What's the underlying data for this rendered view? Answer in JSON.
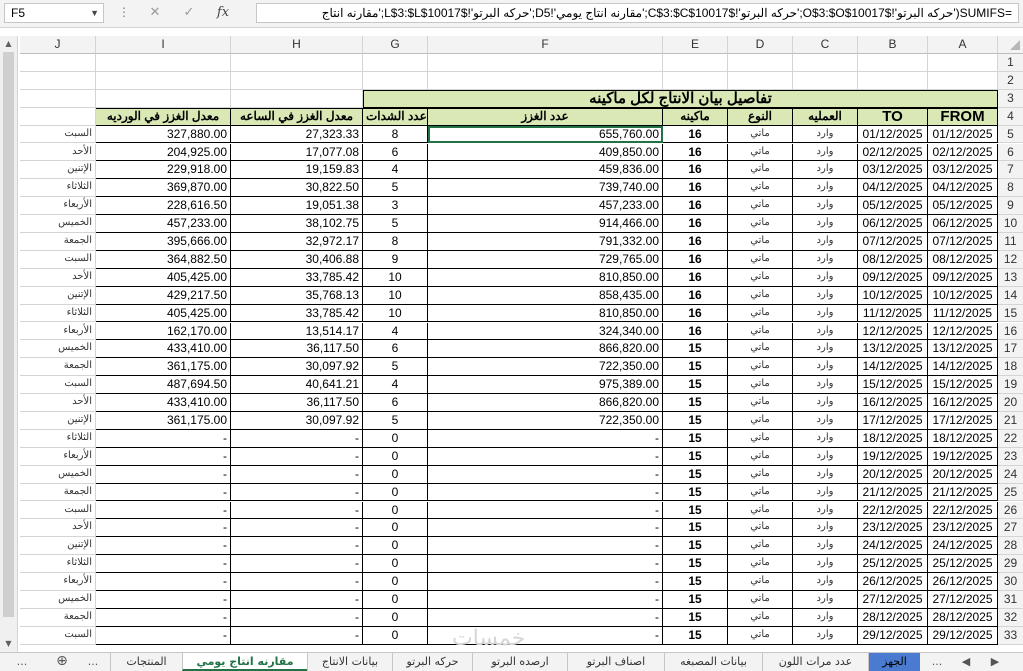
{
  "formula_bar": {
    "name_box": "F5",
    "formula": "=SUMIFS('حركه البرتو'!$O$3:$O$10017;'حركه البرتو'!$C$3:$C$10017;'مقارنه انتاج يومي'!D5;'حركه البرتو'!$L$3:$L$10017;'مقارنه انتاج",
    "cancel_icon": "✕",
    "enter_icon": "✓",
    "fx_label": "fx"
  },
  "columns": [
    "A",
    "B",
    "C",
    "D",
    "E",
    "F",
    "G",
    "H",
    "I",
    "J"
  ],
  "title": "تفاصيل بيان الانتاج لكل ماكينه",
  "headers": {
    "from": "FROM",
    "to": "TO",
    "operation": "العمليه",
    "type": "النوع",
    "machine": "ماكينه",
    "yarn_qty": "عدد الغزز",
    "pulls": "عدد الشدات",
    "rate_hour": "معدل الغزز في الساعه",
    "rate_shift": "معدل الغزز في الورديه"
  },
  "rows": [
    {
      "n": "5",
      "from": "01/12/2025",
      "to": "01/12/2025",
      "op": "وارد",
      "type": "ماتي",
      "machine": "16",
      "qty": "655,760.00",
      "pulls": "8",
      "hour": "27,323.33",
      "shift": "327,880.00",
      "day": "السبت"
    },
    {
      "n": "6",
      "from": "02/12/2025",
      "to": "02/12/2025",
      "op": "وارد",
      "type": "ماتي",
      "machine": "16",
      "qty": "409,850.00",
      "pulls": "6",
      "hour": "17,077.08",
      "shift": "204,925.00",
      "day": "الأحد"
    },
    {
      "n": "7",
      "from": "03/12/2025",
      "to": "03/12/2025",
      "op": "وارد",
      "type": "ماتي",
      "machine": "16",
      "qty": "459,836.00",
      "pulls": "4",
      "hour": "19,159.83",
      "shift": "229,918.00",
      "day": "الإتنين"
    },
    {
      "n": "8",
      "from": "04/12/2025",
      "to": "04/12/2025",
      "op": "وارد",
      "type": "ماتي",
      "machine": "16",
      "qty": "739,740.00",
      "pulls": "5",
      "hour": "30,822.50",
      "shift": "369,870.00",
      "day": "الثلاثاء"
    },
    {
      "n": "9",
      "from": "05/12/2025",
      "to": "05/12/2025",
      "op": "وارد",
      "type": "ماتي",
      "machine": "16",
      "qty": "457,233.00",
      "pulls": "3",
      "hour": "19,051.38",
      "shift": "228,616.50",
      "day": "الأربعاء"
    },
    {
      "n": "10",
      "from": "06/12/2025",
      "to": "06/12/2025",
      "op": "وارد",
      "type": "ماتي",
      "machine": "16",
      "qty": "914,466.00",
      "pulls": "5",
      "hour": "38,102.75",
      "shift": "457,233.00",
      "day": "الخميس"
    },
    {
      "n": "11",
      "from": "07/12/2025",
      "to": "07/12/2025",
      "op": "وارد",
      "type": "ماتي",
      "machine": "16",
      "qty": "791,332.00",
      "pulls": "8",
      "hour": "32,972.17",
      "shift": "395,666.00",
      "day": "الجمعة"
    },
    {
      "n": "12",
      "from": "08/12/2025",
      "to": "08/12/2025",
      "op": "وارد",
      "type": "ماتي",
      "machine": "16",
      "qty": "729,765.00",
      "pulls": "9",
      "hour": "30,406.88",
      "shift": "364,882.50",
      "day": "السبت"
    },
    {
      "n": "13",
      "from": "09/12/2025",
      "to": "09/12/2025",
      "op": "وارد",
      "type": "ماتي",
      "machine": "16",
      "qty": "810,850.00",
      "pulls": "10",
      "hour": "33,785.42",
      "shift": "405,425.00",
      "day": "الأحد"
    },
    {
      "n": "14",
      "from": "10/12/2025",
      "to": "10/12/2025",
      "op": "وارد",
      "type": "ماتي",
      "machine": "16",
      "qty": "858,435.00",
      "pulls": "10",
      "hour": "35,768.13",
      "shift": "429,217.50",
      "day": "الإتنين"
    },
    {
      "n": "15",
      "from": "11/12/2025",
      "to": "11/12/2025",
      "op": "وارد",
      "type": "ماتي",
      "machine": "16",
      "qty": "810,850.00",
      "pulls": "10",
      "hour": "33,785.42",
      "shift": "405,425.00",
      "day": "الثلاثاء"
    },
    {
      "n": "16",
      "from": "12/12/2025",
      "to": "12/12/2025",
      "op": "وارد",
      "type": "ماتي",
      "machine": "16",
      "qty": "324,340.00",
      "pulls": "4",
      "hour": "13,514.17",
      "shift": "162,170.00",
      "day": "الأربعاء"
    },
    {
      "n": "17",
      "from": "13/12/2025",
      "to": "13/12/2025",
      "op": "وارد",
      "type": "ماتي",
      "machine": "15",
      "qty": "866,820.00",
      "pulls": "6",
      "hour": "36,117.50",
      "shift": "433,410.00",
      "day": "الخميس"
    },
    {
      "n": "18",
      "from": "14/12/2025",
      "to": "14/12/2025",
      "op": "وارد",
      "type": "ماتي",
      "machine": "15",
      "qty": "722,350.00",
      "pulls": "5",
      "hour": "30,097.92",
      "shift": "361,175.00",
      "day": "الجمعة"
    },
    {
      "n": "19",
      "from": "15/12/2025",
      "to": "15/12/2025",
      "op": "وارد",
      "type": "ماتي",
      "machine": "15",
      "qty": "975,389.00",
      "pulls": "4",
      "hour": "40,641.21",
      "shift": "487,694.50",
      "day": "السبت"
    },
    {
      "n": "20",
      "from": "16/12/2025",
      "to": "16/12/2025",
      "op": "وارد",
      "type": "ماتي",
      "machine": "15",
      "qty": "866,820.00",
      "pulls": "6",
      "hour": "36,117.50",
      "shift": "433,410.00",
      "day": "الأحد"
    },
    {
      "n": "21",
      "from": "17/12/2025",
      "to": "17/12/2025",
      "op": "وارد",
      "type": "ماتي",
      "machine": "15",
      "qty": "722,350.00",
      "pulls": "5",
      "hour": "30,097.92",
      "shift": "361,175.00",
      "day": "الإتنين"
    },
    {
      "n": "22",
      "from": "18/12/2025",
      "to": "18/12/2025",
      "op": "وارد",
      "type": "ماتي",
      "machine": "15",
      "qty": "-",
      "pulls": "0",
      "hour": "-",
      "shift": "-",
      "day": "الثلاثاء"
    },
    {
      "n": "23",
      "from": "19/12/2025",
      "to": "19/12/2025",
      "op": "وارد",
      "type": "ماتي",
      "machine": "15",
      "qty": "-",
      "pulls": "0",
      "hour": "-",
      "shift": "-",
      "day": "الأربعاء"
    },
    {
      "n": "24",
      "from": "20/12/2025",
      "to": "20/12/2025",
      "op": "وارد",
      "type": "ماتي",
      "machine": "15",
      "qty": "-",
      "pulls": "0",
      "hour": "-",
      "shift": "-",
      "day": "الخميس"
    },
    {
      "n": "25",
      "from": "21/12/2025",
      "to": "21/12/2025",
      "op": "وارد",
      "type": "ماتي",
      "machine": "15",
      "qty": "-",
      "pulls": "0",
      "hour": "-",
      "shift": "-",
      "day": "الجمعة"
    },
    {
      "n": "26",
      "from": "22/12/2025",
      "to": "22/12/2025",
      "op": "وارد",
      "type": "ماتي",
      "machine": "15",
      "qty": "-",
      "pulls": "0",
      "hour": "-",
      "shift": "-",
      "day": "السبت"
    },
    {
      "n": "27",
      "from": "23/12/2025",
      "to": "23/12/2025",
      "op": "وارد",
      "type": "ماتي",
      "machine": "15",
      "qty": "-",
      "pulls": "0",
      "hour": "-",
      "shift": "-",
      "day": "الأحد"
    },
    {
      "n": "28",
      "from": "24/12/2025",
      "to": "24/12/2025",
      "op": "وارد",
      "type": "ماتي",
      "machine": "15",
      "qty": "-",
      "pulls": "0",
      "hour": "-",
      "shift": "-",
      "day": "الإتنين"
    },
    {
      "n": "29",
      "from": "25/12/2025",
      "to": "25/12/2025",
      "op": "وارد",
      "type": "ماتي",
      "machine": "15",
      "qty": "-",
      "pulls": "0",
      "hour": "-",
      "shift": "-",
      "day": "الثلاثاء"
    },
    {
      "n": "30",
      "from": "26/12/2025",
      "to": "26/12/2025",
      "op": "وارد",
      "type": "ماتي",
      "machine": "15",
      "qty": "-",
      "pulls": "0",
      "hour": "-",
      "shift": "-",
      "day": "الأربعاء"
    },
    {
      "n": "31",
      "from": "27/12/2025",
      "to": "27/12/2025",
      "op": "وارد",
      "type": "ماتي",
      "machine": "15",
      "qty": "-",
      "pulls": "0",
      "hour": "-",
      "shift": "-",
      "day": "الخميس"
    },
    {
      "n": "32",
      "from": "28/12/2025",
      "to": "28/12/2025",
      "op": "وارد",
      "type": "ماتي",
      "machine": "15",
      "qty": "-",
      "pulls": "0",
      "hour": "-",
      "shift": "-",
      "day": "الجمعة"
    },
    {
      "n": "33",
      "from": "29/12/2025",
      "to": "29/12/2025",
      "op": "وارد",
      "type": "ماتي",
      "machine": "15",
      "qty": "-",
      "pulls": "0",
      "hour": "-",
      "shift": "-",
      "day": "السبت"
    }
  ],
  "tabs": [
    {
      "label": "الجهز",
      "state": "colored"
    },
    {
      "label": "عدد مرات اللون",
      "state": "normal"
    },
    {
      "label": "بيانات المصبغه",
      "state": "normal"
    },
    {
      "label": "اصناف البرتو",
      "state": "normal"
    },
    {
      "label": "ارصده البرتو",
      "state": "normal"
    },
    {
      "label": "حركه البرتو",
      "state": "normal"
    },
    {
      "label": "بيانات الانتاج",
      "state": "normal"
    },
    {
      "label": "مقارنه انتاج يومي",
      "state": "active"
    },
    {
      "label": "المنتجات",
      "state": "normal"
    }
  ],
  "tab_nav": {
    "prev": "◀",
    "next": "▶",
    "more_left": "...",
    "more_right": "...",
    "add": "⊕"
  },
  "watermark": "خمسات",
  "colors": {
    "header_fill": "#d9e8b4",
    "active_tab": "#217346",
    "colored_tab": "#4a7bd0"
  }
}
